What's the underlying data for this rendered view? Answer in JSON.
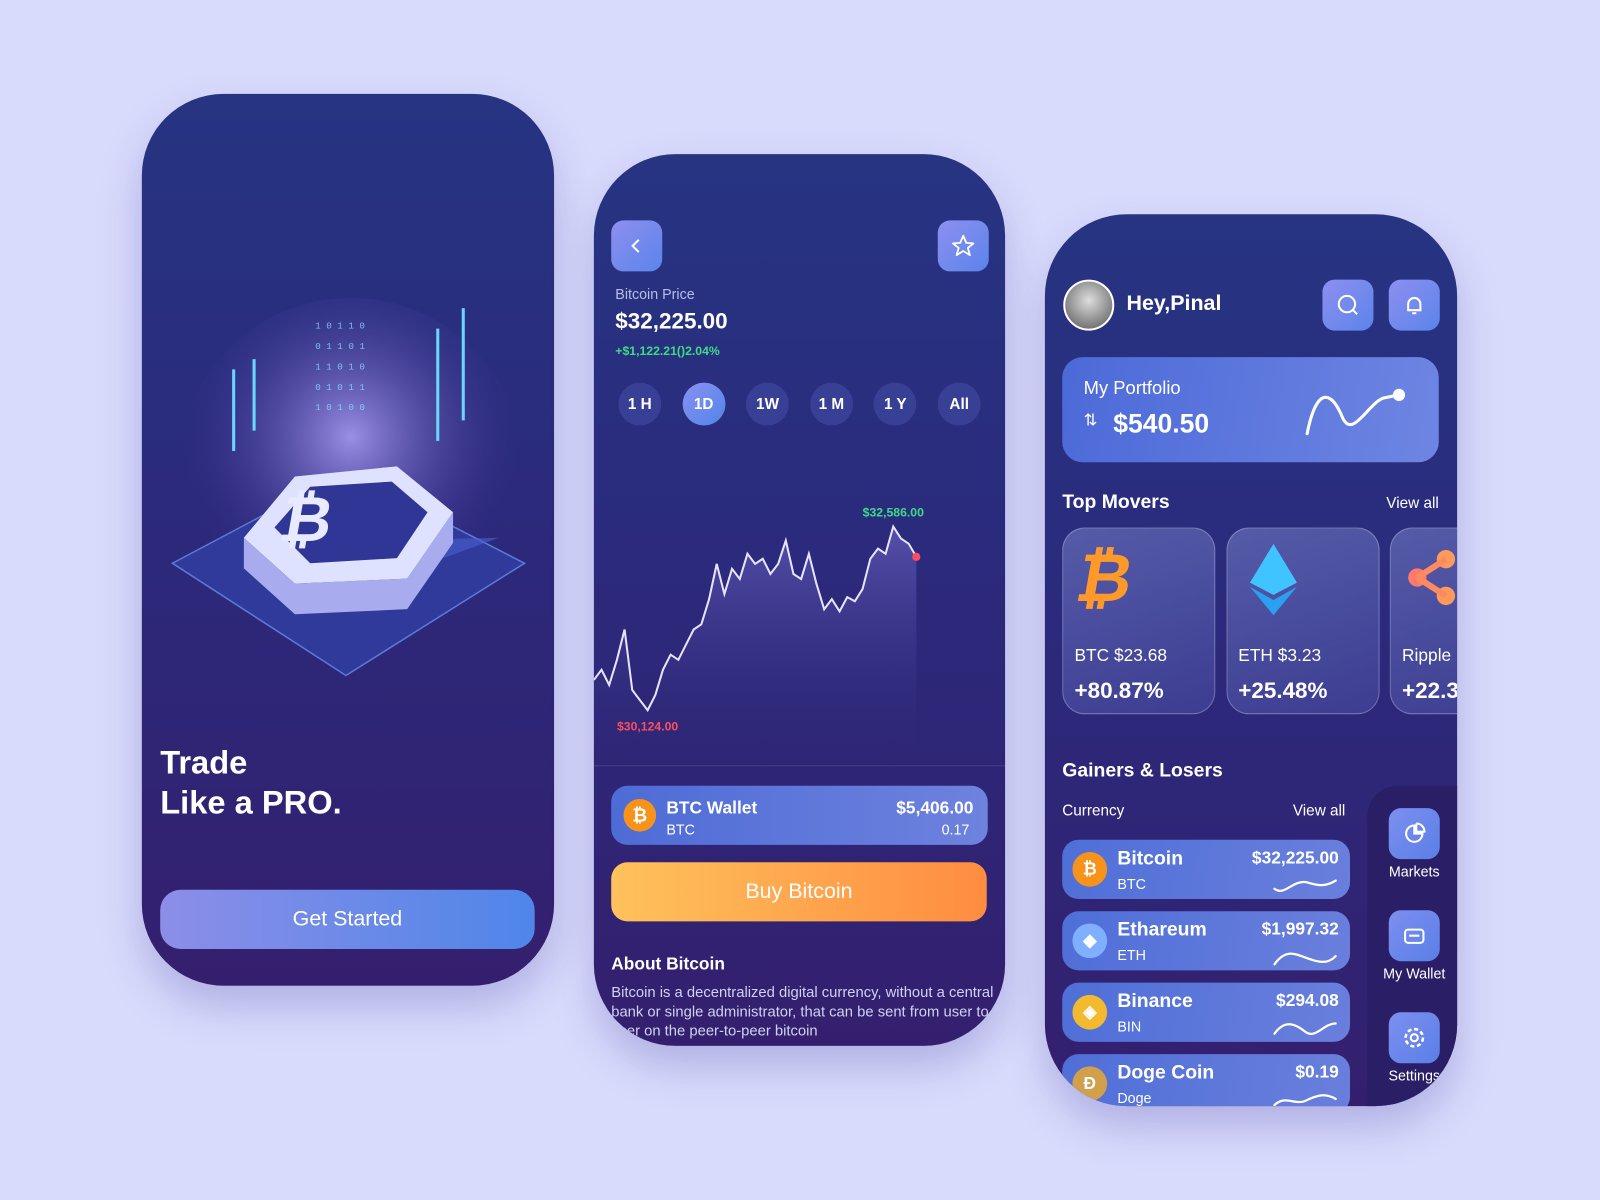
{
  "colors": {
    "background": "#d9dbfc",
    "accent": "#5a84ea",
    "positive": "#3ddc84",
    "negative": "#ff4d5e",
    "buy": "#ff9a3c"
  },
  "onboarding": {
    "title_line1": "Trade",
    "title_line2": "Like a PRO.",
    "cta": "Get Started",
    "illustration": "bitcoin-isometric-chip"
  },
  "detail": {
    "back_icon": "chevron-left-icon",
    "favorite_icon": "star-icon",
    "price_label": "Bitcoin Price",
    "price": "$32,225.00",
    "change": "+$1,122.21()2.04%",
    "ranges": [
      "1 H",
      "1D",
      "1W",
      "1 M",
      "1 Y",
      "All"
    ],
    "active_range": "1D",
    "wallet": {
      "name": "BTC Wallet",
      "symbol": "BTC",
      "value": "$5,406.00",
      "amount": "0.17"
    },
    "buy_label": "Buy Bitcoin",
    "about_title": "About Bitcoin",
    "about_text": "Bitcoin is a decentralized digital currency, without a central bank or single administrator, that can be sent from user to user on the peer-to-peer bitcoin"
  },
  "chart_data": {
    "type": "line",
    "title": "",
    "xlabel": "",
    "ylabel": "",
    "annotations": {
      "max_label": "$32,586.00",
      "min_label": "$30,124.00"
    },
    "max": 32586,
    "min": 30124,
    "values": [
      30530,
      30665,
      30462,
      30800,
      31206,
      30395,
      30259,
      30124,
      30327,
      30665,
      30868,
      30800,
      31003,
      31206,
      31274,
      31612,
      32086,
      31680,
      32018,
      31883,
      32221,
      32086,
      32154,
      31950,
      32086,
      32397,
      31950,
      31883,
      32221,
      31815,
      31477,
      31612,
      31450,
      31639,
      31585,
      31748,
      32154,
      32289,
      32221,
      32586,
      32424,
      32356,
      32180
    ],
    "grid": false
  },
  "home": {
    "greeting": "Hey,Pinal",
    "search_icon": "search-icon",
    "bell_icon": "bell-icon",
    "portfolio": {
      "label": "My Portfolio",
      "value": "$540.50"
    },
    "top_movers_title": "Top Movers",
    "view_all": "View all",
    "movers": [
      {
        "label": "BTC $23.68",
        "change": "+80.87%",
        "icon": "bitcoin-icon"
      },
      {
        "label": "ETH $3.23",
        "change": "+25.48%",
        "icon": "ethereum-icon"
      },
      {
        "label": "Ripple",
        "change": "+22.3",
        "icon": "ripple-icon"
      }
    ],
    "gainers_title": "Gainers & Losers",
    "currency_label": "Currency",
    "view_all2": "View all",
    "rows": [
      {
        "name": "Bitcoin",
        "symbol": "BTC",
        "price": "$32,225.00",
        "color": "#f7931a",
        "glyph": "₿"
      },
      {
        "name": "Ethareum",
        "symbol": "ETH",
        "price": "$1,997.32",
        "color": "#7fb0ff",
        "glyph": "◆"
      },
      {
        "name": "Binance",
        "symbol": "BIN",
        "price": "$294.08",
        "color": "#f3ba2f",
        "glyph": "◈"
      },
      {
        "name": "Doge Coin",
        "symbol": "Doge",
        "price": "$0.19",
        "color": "#d2a04a",
        "glyph": "Ð"
      }
    ],
    "nav": [
      {
        "label": "Markets",
        "icon": "pie-chart-icon"
      },
      {
        "label": "My Wallet",
        "icon": "wallet-icon"
      },
      {
        "label": "Settings",
        "icon": "gear-icon"
      }
    ]
  }
}
